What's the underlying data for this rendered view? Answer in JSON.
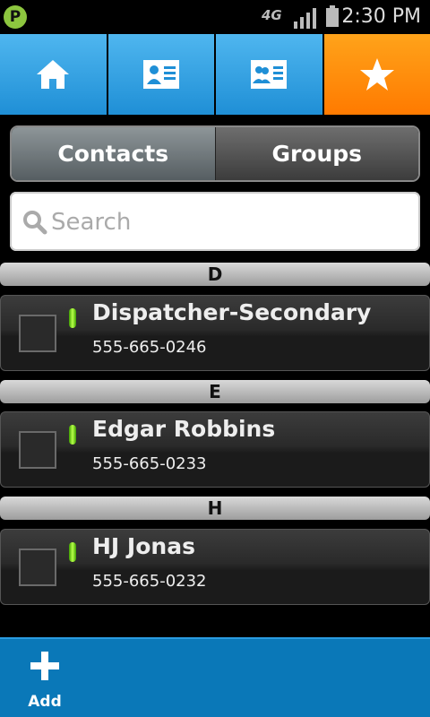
{
  "status_bar": {
    "app_badge": "P",
    "network": "4G",
    "time": "2:30 PM"
  },
  "nav_tabs": [
    {
      "icon": "home-icon",
      "active": false
    },
    {
      "icon": "contact-card-icon",
      "active": false
    },
    {
      "icon": "group-card-icon",
      "active": false
    },
    {
      "icon": "star-icon",
      "active": true
    }
  ],
  "segment": {
    "contacts_label": "Contacts",
    "groups_label": "Groups",
    "selected": "Contacts"
  },
  "search": {
    "placeholder": "Search",
    "value": ""
  },
  "sections": [
    {
      "letter": "D",
      "contacts": [
        {
          "name": "Dispatcher-Secondary",
          "phone": "555-665-0246",
          "presence": "available"
        }
      ]
    },
    {
      "letter": "E",
      "contacts": [
        {
          "name": "Edgar Robbins",
          "phone": "555-665-0233",
          "presence": "available"
        }
      ]
    },
    {
      "letter": "H",
      "contacts": [
        {
          "name": "HJ Jonas",
          "phone": "555-665-0232",
          "presence": "available"
        }
      ]
    }
  ],
  "bottom_bar": {
    "add_label": "Add"
  },
  "colors": {
    "tab_blue": "#1f8fd6",
    "tab_active_orange": "#ff7a00",
    "presence_green": "#7fe01a",
    "bottom_bar_blue": "#0a78b8"
  }
}
